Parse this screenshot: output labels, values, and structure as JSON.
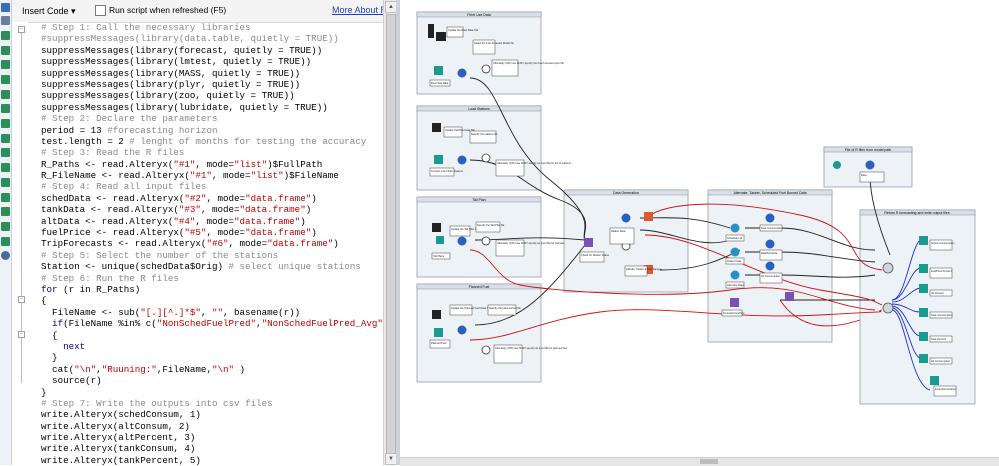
{
  "toolbar": {
    "insert_code_label": "Insert Code ▾",
    "run_script_label": "Run script when refreshed (F5)",
    "more_about_label": "More About R"
  },
  "colors": {
    "comment": "#8a8a8a",
    "keyword": "#000080",
    "string": "#c00000",
    "link": "#1a42c8",
    "wire_red": "#cc1111",
    "wire_blue": "#1a2ed8",
    "container_bg": "#edf2f7"
  },
  "code_lines": [
    [
      [
        "c-com",
        "  # Step 1: Call the necessary libraries"
      ]
    ],
    [
      [
        "c-com",
        "  #suppressMessages(library(data.table, quietly = TRUE))"
      ]
    ],
    [
      [
        "c-txt",
        "  suppressMessages(library(forecast, quietly = TRUE))"
      ]
    ],
    [
      [
        "c-txt",
        "  suppressMessages(library(lmtest, quietly = TRUE))"
      ]
    ],
    [
      [
        "c-txt",
        "  suppressMessages(library(MASS, quietly = TRUE))"
      ]
    ],
    [
      [
        "c-txt",
        "  suppressMessages(library(plyr, quietly = TRUE))"
      ]
    ],
    [
      [
        "c-txt",
        "  suppressMessages(library(zoo, quietly = TRUE))"
      ]
    ],
    [
      [
        "c-txt",
        "  suppressMessages(library(lubridate, quietly = TRUE))"
      ]
    ],
    [
      [
        "c-com",
        "  # Step 2: Declare the parameters"
      ]
    ],
    [
      [
        "c-txt",
        "  period = "
      ],
      [
        "c-num",
        "13"
      ],
      [
        "c-com",
        " #forecasting horizon"
      ]
    ],
    [
      [
        "c-txt",
        "  test.length = "
      ],
      [
        "c-num",
        "2"
      ],
      [
        "c-com",
        " # lenght of months for testing the accuracy"
      ]
    ],
    [
      [
        "c-com",
        "  # Step 3: Read the R files"
      ]
    ],
    [
      [
        "c-txt",
        "  R_Paths <- read.Alteryx("
      ],
      [
        "c-str",
        "\"#1\""
      ],
      [
        "c-txt",
        ", mode="
      ],
      [
        "c-str",
        "\"list\""
      ],
      [
        "c-txt",
        ")$FullPath"
      ]
    ],
    [
      [
        "c-txt",
        "  R_FileName <- read.Alteryx("
      ],
      [
        "c-str",
        "\"#1\""
      ],
      [
        "c-txt",
        ", mode="
      ],
      [
        "c-str",
        "\"list\""
      ],
      [
        "c-txt",
        ")$FileName"
      ]
    ],
    [
      [
        "c-com",
        "  # Step 4: Read all input files"
      ]
    ],
    [
      [
        "c-txt",
        "  schedData <- read.Alteryx("
      ],
      [
        "c-str",
        "\"#2\""
      ],
      [
        "c-txt",
        ", mode="
      ],
      [
        "c-str",
        "\"data.frame\""
      ],
      [
        "c-txt",
        ")"
      ]
    ],
    [
      [
        "c-txt",
        "  tankData <- read.Alteryx("
      ],
      [
        "c-str",
        "\"#3\""
      ],
      [
        "c-txt",
        ", mode="
      ],
      [
        "c-str",
        "\"data.frame\""
      ],
      [
        "c-txt",
        ")"
      ]
    ],
    [
      [
        "c-txt",
        "  altData <- read.Alteryx("
      ],
      [
        "c-str",
        "\"#4\""
      ],
      [
        "c-txt",
        ", mode="
      ],
      [
        "c-str",
        "\"data.frame\""
      ],
      [
        "c-txt",
        ")"
      ]
    ],
    [
      [
        "c-txt",
        "  fuelPrice <- read.Alteryx("
      ],
      [
        "c-str",
        "\"#5\""
      ],
      [
        "c-txt",
        ", mode="
      ],
      [
        "c-str",
        "\"data.frame\""
      ],
      [
        "c-txt",
        ")"
      ]
    ],
    [
      [
        "c-txt",
        "  TripForecasts <- read.Alteryx("
      ],
      [
        "c-str",
        "\"#6\""
      ],
      [
        "c-txt",
        ", mode="
      ],
      [
        "c-str",
        "\"data.frame\""
      ],
      [
        "c-txt",
        ")"
      ]
    ],
    [
      [
        "c-com",
        "  # Step 5: Select the number of the stations"
      ]
    ],
    [
      [
        "c-txt",
        "  Station <- unique(schedData$Orig)"
      ],
      [
        "c-com",
        " # select unique stations"
      ]
    ],
    [
      [
        "c-com",
        "  # Step 6: Run the R files"
      ]
    ],
    [
      [
        "c-kw",
        "  for"
      ],
      [
        "c-txt",
        " (r in R_Paths)"
      ]
    ],
    [
      [
        "c-txt",
        "  {"
      ]
    ],
    [
      [
        "c-txt",
        "    FileName <- sub("
      ],
      [
        "c-str",
        "\"[.][^.]*$\""
      ],
      [
        "c-txt",
        ", "
      ],
      [
        "c-str",
        "\"\""
      ],
      [
        "c-txt",
        ", basename(r))"
      ]
    ],
    [
      [
        "c-kw",
        "    if"
      ],
      [
        "c-txt",
        "(FileName %in% c("
      ],
      [
        "c-str",
        "\"NonSchedFuelPred\""
      ],
      [
        "c-txt",
        ","
      ],
      [
        "c-str",
        "\"NonSchedFuelPred_Avg\""
      ],
      [
        "c-txt",
        "))"
      ]
    ],
    [
      [
        "c-txt",
        "    {"
      ]
    ],
    [
      [
        "c-kw",
        "      next"
      ]
    ],
    [
      [
        "c-txt",
        "    }"
      ]
    ],
    [
      [
        "c-txt",
        "    cat("
      ],
      [
        "c-str",
        "\"\\n\""
      ],
      [
        "c-txt",
        ","
      ],
      [
        "c-str",
        "\"Ruuning:\""
      ],
      [
        "c-txt",
        ",FileName,"
      ],
      [
        "c-str",
        "\"\\n\""
      ],
      [
        "c-txt",
        " )"
      ]
    ],
    [
      [
        "c-txt",
        "    source(r)"
      ]
    ],
    [
      [
        "c-txt",
        "  }"
      ]
    ],
    [
      [
        "c-com",
        "  # Step 7: Write the outputs into csv files"
      ]
    ],
    [
      [
        "c-txt",
        "  write.Alteryx(schedConsum, "
      ],
      [
        "c-num",
        "1"
      ],
      [
        "c-txt",
        ")"
      ]
    ],
    [
      [
        "c-txt",
        "  write.Alteryx(altConsum, "
      ],
      [
        "c-num",
        "2"
      ],
      [
        "c-txt",
        ")"
      ]
    ],
    [
      [
        "c-txt",
        "  write.Alteryx(altPercent, "
      ],
      [
        "c-num",
        "3"
      ],
      [
        "c-txt",
        ")"
      ]
    ],
    [
      [
        "c-txt",
        "  write.Alteryx(tankConsum, "
      ],
      [
        "c-num",
        "4"
      ],
      [
        "c-txt",
        ")"
      ]
    ],
    [
      [
        "c-txt",
        "  write.Alteryx(tankPercent, "
      ],
      [
        "c-num",
        "5"
      ],
      [
        "c-txt",
        ")"
      ]
    ]
  ],
  "workflow": {
    "containers": [
      {
        "id": "c1",
        "title": "Fleet Use Data"
      },
      {
        "id": "c2",
        "title": "Load Stations"
      },
      {
        "id": "c3",
        "title": "Tail Plan"
      },
      {
        "id": "c4",
        "title": "Planned Fuel"
      },
      {
        "id": "c5",
        "title": "Data Generation"
      },
      {
        "id": "c6",
        "title": "Alternate, Tanker, Scheduled Fuel Burned Data"
      },
      {
        "id": "c7",
        "title": "File of R files from model path"
      },
      {
        "id": "c8",
        "title": "Return R forecasting and write output files"
      }
    ],
    "notes": [
      "Update the Fleet Data Tab",
      "Select the Fuel Forecast Model file",
      "Ultimately (OR) Use NUST specify the Fuel Forecast input file.",
      "Update Tail Plan Data Tab",
      "Specify the stations file",
      "Ultimately (OR) Use NUST specify an input file for list of stations",
      "Update the Tail Plan Data Tab",
      "Specify the Tail Plan file",
      "Ultimately (OR) Use NUST specify an input file for Tail plan",
      "Update the Planned Fuel Data Tab",
      "Specify the planned fuel file",
      "Ultimately (OR) Use NUST specify an input file for planned fuel",
      "Convert Line Flight Stations",
      "Check for Station Status",
      "Tail Plans",
      "Planned Fuel",
      "Fleet Stat Data",
      "Station Data",
      "Altitude, Tanker & Fuel Ranges",
      "Schedule Ltd",
      "Tanker Data",
      "Alternate Data",
      "Tank Consumption",
      "DataSchedule",
      "Alt Consumption",
      "Alt Percent",
      "Tank Consumption",
      "Tank Percent",
      "Sched Consumption",
      "FuelPrice Percent",
      "ForecastConsPerc",
      "Data"
    ]
  }
}
